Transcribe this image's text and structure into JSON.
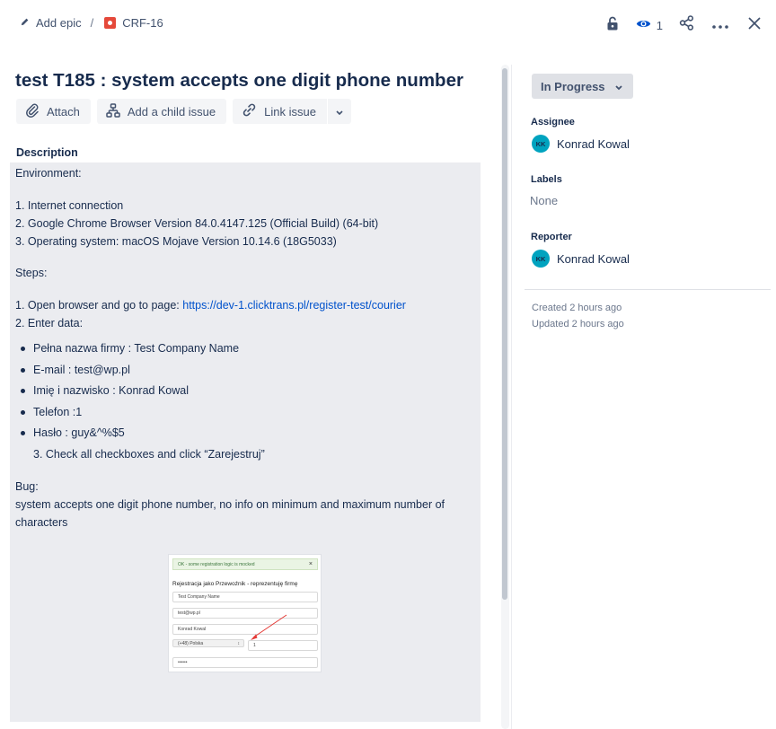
{
  "breadcrumb": {
    "epic_label": "Add epic",
    "separator": "/",
    "issue_key": "CRF-16"
  },
  "toolbar": {
    "watch_count": "1"
  },
  "issue": {
    "title": "test T185 : system accepts one digit phone number"
  },
  "actions": {
    "attach": "Attach",
    "add_child": "Add a child issue",
    "link_issue": "Link issue"
  },
  "description": {
    "label": "Description",
    "environment_heading": "Environment:",
    "environment_items": [
      "1. Internet connection",
      "2. Google Chrome Browser Version 84.0.4147.125 (Official Build) (64-bit)",
      "3. Operating system: macOS Mojave Version 10.14.6 (18G5033)"
    ],
    "steps_heading": "Steps:",
    "step1_prefix": "1. Open browser and go to page: ",
    "step1_link": "https://dev-1.clicktrans.pl/register-test/courier",
    "step2": "2. Enter data:",
    "data_items": [
      "Pełna nazwa firmy : Test Company Name",
      "E-mail : test@wp.pl",
      "Imię i nazwisko : Konrad Kowal",
      "Telefon :1",
      "Hasło : guy&^%$5"
    ],
    "step3": "3. Check all checkboxes and click “Zarejestruj”",
    "bug_heading": "Bug:",
    "bug_text": "system accepts one digit phone number, no info on minimum and maximum number of characters"
  },
  "attachment": {
    "alert_text": "OK - some registration logic is mocked",
    "alert_close": "×",
    "heading": "Rejestracja jako Przewoźnik - reprezentuję firmę",
    "company": "Test Company Name",
    "email": "test@wp.pl",
    "name": "Konrad Kowal",
    "country": "(+48) Polska",
    "phone": "1",
    "password": "••••••"
  },
  "side": {
    "status": "In Progress",
    "assignee_label": "Assignee",
    "assignee_initials": "KK",
    "assignee_name": "Konrad Kowal",
    "labels_label": "Labels",
    "labels_value": "None",
    "reporter_label": "Reporter",
    "reporter_initials": "KK",
    "reporter_name": "Konrad Kowal",
    "created": "Created 2 hours ago",
    "updated": "Updated 2 hours ago"
  },
  "colors": {
    "link": "#0052cc",
    "avatar": "#00a3bf",
    "bug_icon": "#e5493a",
    "watch_icon": "#0052cc",
    "annotation_arrow": "#e53935"
  },
  "icons": [
    "pencil-icon",
    "bug-icon",
    "unlock-icon",
    "eye-icon",
    "share-icon",
    "more-icon",
    "close-icon",
    "paperclip-icon",
    "child-issue-icon",
    "link-icon",
    "chevron-down-icon"
  ]
}
